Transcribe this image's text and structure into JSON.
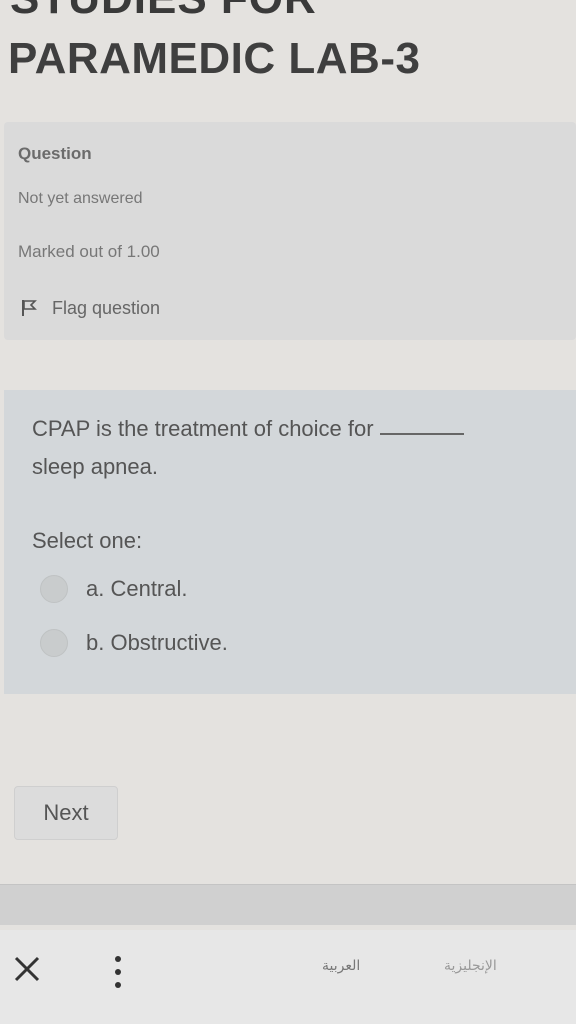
{
  "header": {
    "course_title_partial": "STUDIES FOR",
    "page_title": "PARAMEDIC LAB-3"
  },
  "question_info": {
    "label": "Question",
    "state": "Not yet answered",
    "grade": "Marked out of 1.00",
    "flag_label": "Flag question",
    "flag_icon": "flag-icon"
  },
  "question": {
    "text_line1": "CPAP is the treatment of choice for",
    "text_line2": "sleep apnea.",
    "prompt": "Select one:",
    "options": [
      {
        "label": "a. Central."
      },
      {
        "label": "b. Obstructive."
      }
    ]
  },
  "navigation": {
    "next_label": "Next"
  },
  "browser_bar": {
    "close_icon": "close-icon",
    "menu_icon": "more-vert-icon",
    "lang_arabic": "العربية",
    "lang_english": "الإنجليزية"
  },
  "colors": {
    "page_bg": "#e4e2df",
    "info_box_bg": "#dadada",
    "formulation_bg": "#d3d7da"
  }
}
